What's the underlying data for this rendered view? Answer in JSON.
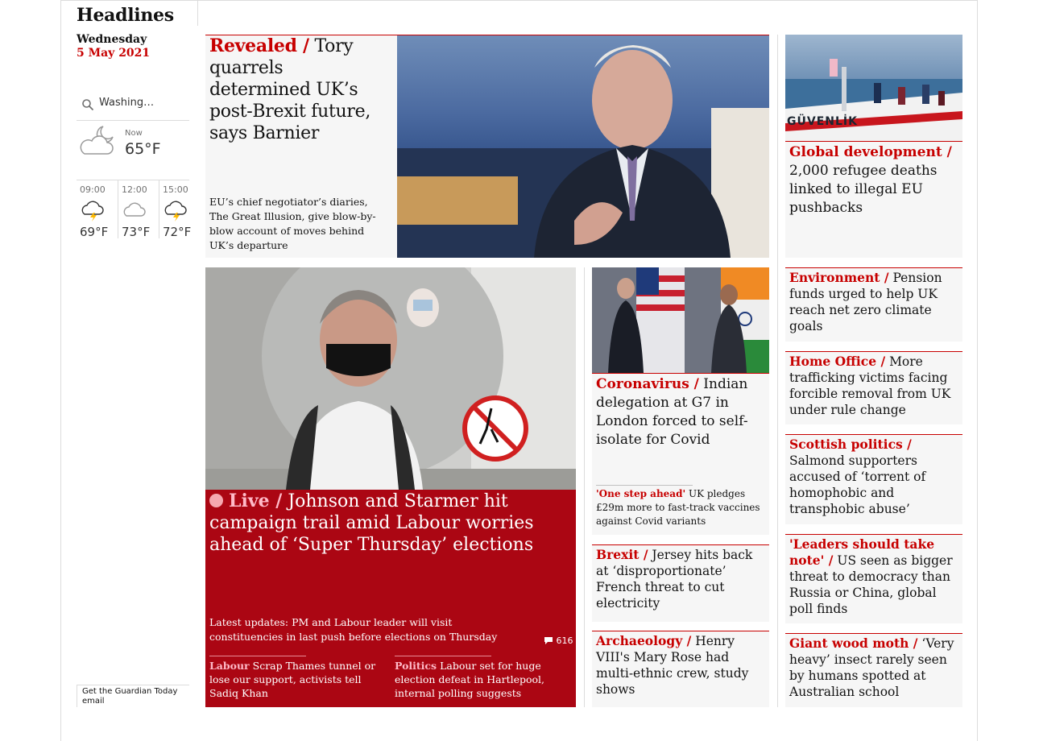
{
  "section": {
    "title": "Headlines",
    "day": "Wednesday",
    "date": "5 May 2021"
  },
  "weather": {
    "location": "Washing…",
    "now_label": "Now",
    "now_temp": "65°F",
    "forecast": [
      {
        "time": "09:00",
        "temp": "69°F",
        "icon": "cloud-lightning-icon"
      },
      {
        "time": "12:00",
        "temp": "73°F",
        "icon": "cloud-icon"
      },
      {
        "time": "15:00",
        "temp": "72°F",
        "icon": "cloud-lightning-icon"
      }
    ]
  },
  "signup": "Get the Guardian Today email",
  "stories": {
    "barnier": {
      "kicker": "Revealed /",
      "headline": "Tory quarrels determined UK’s post-Brexit future, says Barnier",
      "standfirst": "EU’s chief negotiator’s diaries, The Great Illusion, give blow-by-blow account of moves behind UK’s departure"
    },
    "refugee": {
      "kicker": "Global development /",
      "headline": "2,000 refugee deaths linked to illegal EU pushbacks",
      "image_text": "GÜVENLİK"
    },
    "live": {
      "kicker": "Live /",
      "headline": "Johnson and Starmer hit campaign trail amid Labour worries ahead of ‘Super Thursday’ elections",
      "standfirst": "Latest updates: PM and Labour leader will visit constituencies in last push before elections on Thursday",
      "comments": "616",
      "sub": [
        {
          "kicker": "Labour",
          "headline": "Scrap Thames tunnel or lose our support, activists tell Sadiq Khan"
        },
        {
          "kicker": "Politics",
          "headline": "Labour set for huge election defeat in Hartlepool, internal polling suggests"
        }
      ]
    },
    "india": {
      "kicker": "Coronavirus /",
      "headline": "Indian delegation at G7 in London forced to self-isolate for Covid",
      "sub_kicker": "'One step ahead'",
      "sub_headline": "UK pledges £29m more to fast-track vaccines against Covid variants"
    },
    "brexit": {
      "kicker": "Brexit /",
      "headline": "Jersey hits back at ‘disproportionate’ French threat to cut electricity"
    },
    "archaeology": {
      "kicker": "Archaeology /",
      "headline": "Henry VIII's Mary Rose had multi-ethnic crew, study shows"
    },
    "environment": {
      "kicker": "Environment /",
      "headline": "Pension funds urged to help UK reach net zero climate goals"
    },
    "homeoffice": {
      "kicker": "Home Office /",
      "headline": "More trafficking victims facing forcible removal from UK under rule change"
    },
    "scottish": {
      "kicker": "Scottish politics /",
      "headline": "Salmond supporters accused of ‘torrent of homophobic and transphobic abuse’"
    },
    "leaders": {
      "kicker": "'Leaders should take note' /",
      "headline": "US seen as bigger threat to democracy than Russia or China, global poll finds"
    },
    "moth": {
      "kicker": "Giant wood moth /",
      "headline": "‘Very heavy’ insect rarely seen by humans spotted at Australian school"
    }
  },
  "colors": {
    "news_red": "#c70000",
    "live_red": "#ab0613",
    "card_bg": "#f6f6f6"
  }
}
